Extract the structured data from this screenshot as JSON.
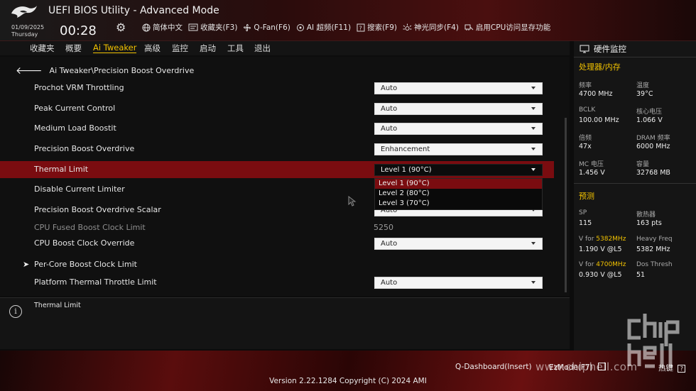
{
  "header": {
    "title": "UEFI BIOS Utility - Advanced Mode",
    "date": "01/09/2025",
    "weekday": "Thursday",
    "time": "00:28",
    "tools": [
      {
        "icon": "globe-icon",
        "label": "简体中文"
      },
      {
        "icon": "favorites-icon",
        "label": "收藏夹(F3)"
      },
      {
        "icon": "fan-icon",
        "label": "Q-Fan(F6)"
      },
      {
        "icon": "ai-icon",
        "label": "AI 超频(F11)"
      },
      {
        "icon": "question-icon",
        "label": "搜索(F9)"
      },
      {
        "icon": "light-icon",
        "label": "神光同步(F4)"
      },
      {
        "icon": "memory-icon",
        "label": "启用CPU访问显存功能"
      }
    ]
  },
  "nav": {
    "items": [
      "收藏夹",
      "概要",
      "Ai Tweaker",
      "高级",
      "监控",
      "启动",
      "工具",
      "退出"
    ],
    "active": "Ai Tweaker"
  },
  "breadcrumb": "Ai Tweaker\\Precision Boost Overdrive",
  "settings": [
    {
      "label": "Prochot VRM Throttling",
      "value": "Auto"
    },
    {
      "label": "Peak Current Control",
      "value": "Auto"
    },
    {
      "label": "Medium Load Boostit",
      "value": "Auto"
    },
    {
      "label": "Precision Boost Overdrive",
      "value": "Enhancement"
    },
    {
      "label": "Thermal Limit",
      "value": "Level 1 (90°C)"
    },
    {
      "label": "Disable Current Limiter",
      "value": ""
    },
    {
      "label": "Precision Boost Overdrive Scalar",
      "value": "Auto"
    },
    {
      "label": "CPU Fused Boost Clock Limit",
      "value": "5250"
    },
    {
      "label": "CPU Boost Clock Override",
      "value": "Auto"
    },
    {
      "label": "Per-Core Boost Clock Limit",
      "value": ""
    },
    {
      "label": "Platform Thermal Throttle Limit",
      "value": "Auto"
    }
  ],
  "dropdown": {
    "options": [
      "Level 1 (90°C)",
      "Level 2 (80°C)",
      "Level 3 (70°C)"
    ],
    "selected": "Level 1 (90°C)"
  },
  "help": {
    "text": "Thermal Limit"
  },
  "hardware_monitor": {
    "title": "硬件监控",
    "cpu_section": "处理器/内存",
    "metrics": [
      {
        "label": "频率",
        "value": "4700 MHz"
      },
      {
        "label": "温度",
        "value": "39°C"
      },
      {
        "label": "BCLK",
        "value": "100.00 MHz"
      },
      {
        "label": "核心电压",
        "value": "1.066 V"
      },
      {
        "label": "倍频",
        "value": "47x"
      },
      {
        "label": "DRAM 频率",
        "value": "6000 MHz"
      },
      {
        "label": "MC 电压",
        "value": "1.456 V"
      },
      {
        "label": "容量",
        "value": "32768 MB"
      }
    ],
    "predict_section": "预测",
    "predict": [
      {
        "label": "SP",
        "value": "115"
      },
      {
        "label": "散热器",
        "value": "163 pts"
      },
      {
        "label_prefix": "V for ",
        "label_freq": "5382MHz",
        "value": "1.190 V @L5"
      },
      {
        "label": "Heavy Freq",
        "value": "5382 MHz"
      },
      {
        "label_prefix": "V for ",
        "label_freq": "4700MHz",
        "value": "0.930 V @L5"
      },
      {
        "label": "Dos Thresh",
        "value": "51"
      }
    ]
  },
  "footer": {
    "version": "Version 2.22.1284 Copyright (C) 2024 AMI",
    "qdashboard": "Q-Dashboard(Insert)",
    "ez_mode": "EzMode(F7)",
    "hotkeys": "热键"
  },
  "watermark": "www.chiphell.com",
  "colors": {
    "accent": "#f2c200",
    "selected_row": "#7a0c10"
  }
}
